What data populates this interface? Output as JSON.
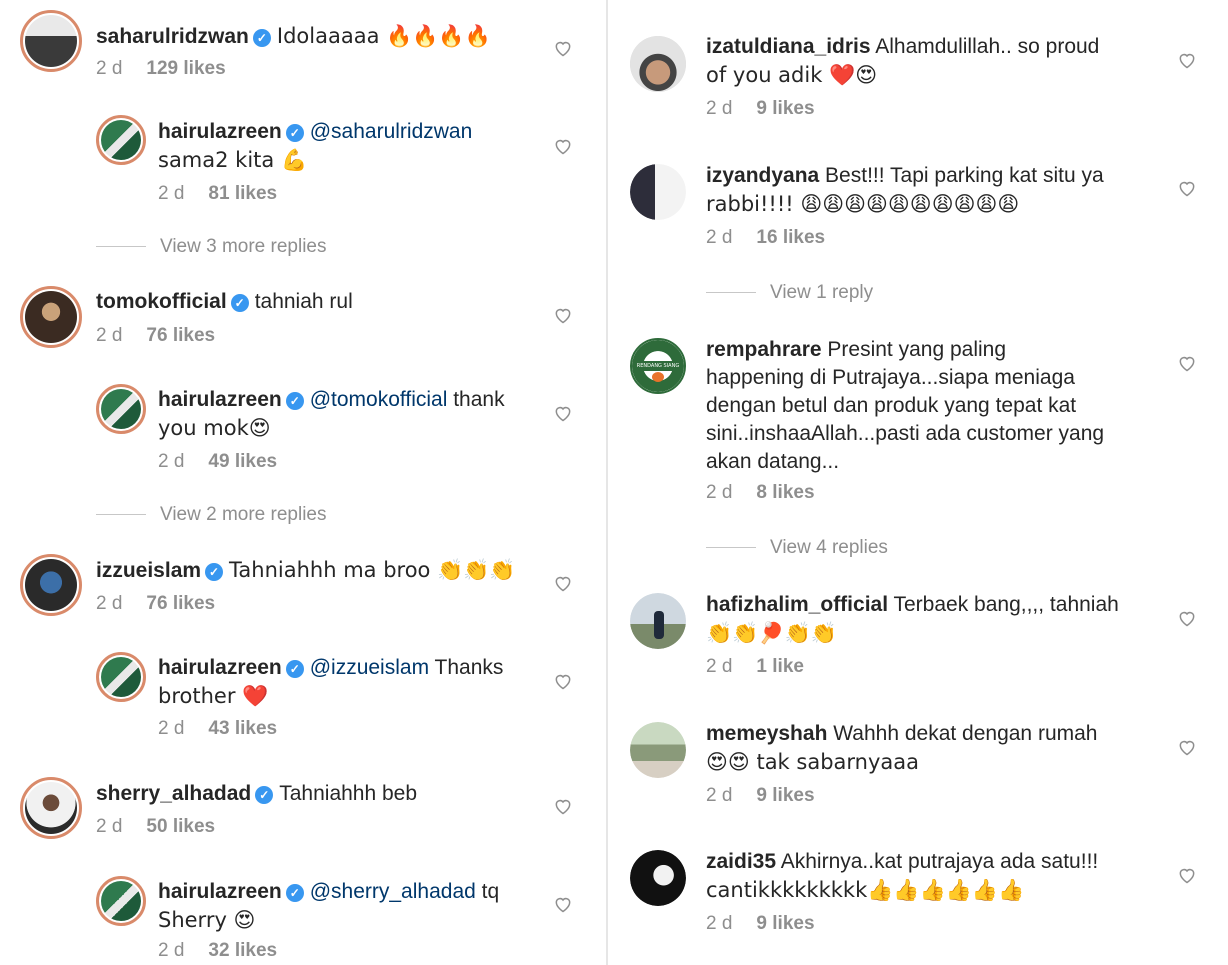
{
  "left": {
    "c1": {
      "user": "saharulridzwan",
      "text": "Idolaaaaa 🔥🔥🔥🔥",
      "age": "2 d",
      "likes": "129 likes"
    },
    "r1": {
      "user": "hairulazreen",
      "mention": "@saharulridzwan",
      "text1": "",
      "text2": "sama2 kita 💪",
      "age": "2 d",
      "likes": "81 likes"
    },
    "v1": "View 3 more replies",
    "c2": {
      "user": "tomokofficial",
      "text": "tahniah rul",
      "age": "2 d",
      "likes": "76 likes"
    },
    "r2": {
      "user": "hairulazreen",
      "mention": "@tomokofficial",
      "text1": " thank",
      "text2": "you mok😍",
      "age": "2 d",
      "likes": "49 likes"
    },
    "v2": "View 2 more replies",
    "c3": {
      "user": "izzueislam",
      "text": "Tahniahhh ma broo 👏👏👏",
      "age": "2 d",
      "likes": "76 likes"
    },
    "r3": {
      "user": "hairulazreen",
      "mention": "@izzueislam",
      "text1": " Thanks",
      "text2": "brother ❤️",
      "age": "2 d",
      "likes": "43 likes"
    },
    "c4": {
      "user": "sherry_alhadad",
      "text": "Tahniahhh beb",
      "age": "2 d",
      "likes": "50 likes"
    },
    "r4": {
      "user": "hairulazreen",
      "mention": "@sherry_alhadad",
      "text1": " tq",
      "text2": "Sherry 😍",
      "age": "2 d",
      "likes": "32 likes"
    }
  },
  "right": {
    "c1": {
      "user": "izatuldiana_idris",
      "text1": " Alhamdulillah.. so proud",
      "text2": "of you adik ❤️😍",
      "age": "2 d",
      "likes": "9 likes"
    },
    "c2": {
      "user": "izyandyana",
      "text1": " Best!!! Tapi parking kat situ ya",
      "text2": "rabbi!!!! 😩😩😩😩😩😩😩😩😩😩",
      "age": "2 d",
      "likes": "16 likes"
    },
    "v1": "View 1 reply",
    "c3": {
      "user": "rempahrare",
      "text1": " Presint yang paling",
      "text2": "happening di Putrajaya...siapa meniaga",
      "text3": "dengan betul dan produk yang tepat kat",
      "text4": "sini..inshaaAllah...pasti ada customer yang",
      "text5": "akan datang...",
      "age": "2 d",
      "likes": "8 likes",
      "logo_text": "RENDANG SIANG BAKAR"
    },
    "v2": "View 4 replies",
    "c4": {
      "user": "hafizhalim_official",
      "text1": " Terbaek bang,,,, tahniah",
      "text2": "👏👏🏓👏👏",
      "age": "2 d",
      "likes": "1 like"
    },
    "c5": {
      "user": "memeyshah",
      "text1": " Wahhh dekat dengan rumah",
      "text2": "😍😍 tak sabarnyaaa",
      "age": "2 d",
      "likes": "9 likes"
    },
    "c6": {
      "user": "zaidi35",
      "text1": " Akhirnya..kat putrajaya ada satu!!!",
      "text2": "cantikkkkkkkkk👍👍👍👍👍👍",
      "age": "2 d",
      "likes": "9 likes"
    }
  },
  "icons": {
    "heart": "heart-outline-icon",
    "verified": "verified-badge-icon"
  },
  "colors": {
    "mention": "#00376b",
    "verified": "#3897f0",
    "meta": "#8e8e8e",
    "ring": "#d98a6a"
  }
}
